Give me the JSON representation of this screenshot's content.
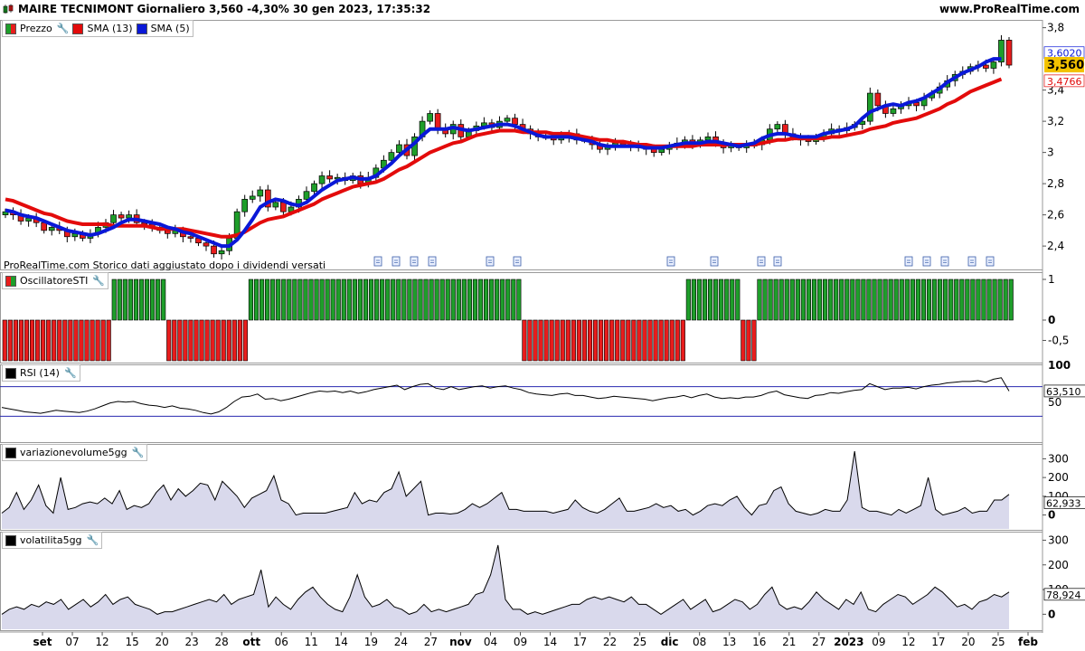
{
  "header": {
    "title": "MAIRE TECNIMONT Giornaliero 3,560 -4,30% 30 gen 2023, 17:35:32",
    "site": "www.ProRealTime.com"
  },
  "colors": {
    "bull": "#1e9e2a",
    "bear": "#e81c1c",
    "sma13": "#e30b0b",
    "sma5": "#0a18d8",
    "area_fill": "#d9d9ec",
    "rsi_band": "#2a2ab0",
    "last_price_bg": "#f2c200"
  },
  "panels": {
    "price": {
      "legend": [
        {
          "label": "Prezzo",
          "color": "#1e9e2a",
          "icon": "wrench-icon"
        },
        {
          "label": "SMA (13)",
          "color": "#e30b0b"
        },
        {
          "label": "SMA (5)",
          "color": "#0a18d8"
        }
      ],
      "note": "ProRealTime.com  Storico dati aggiustato dopo i dividendi versati",
      "last_price": "3,560",
      "sma5_value": "3,6020",
      "sma13_value": "3,4766"
    },
    "sti": {
      "title": "OscillatoreSTI",
      "last": "1"
    },
    "rsi": {
      "title": "RSI (14)",
      "last": "63,510"
    },
    "vol": {
      "title": "variazionevolume5gg",
      "last": "62,933"
    },
    "vola": {
      "title": "volatilita5gg",
      "last": "78,924"
    }
  },
  "chart_data": [
    {
      "type": "candlestick",
      "title": "MAIRE TECNIMONT Giornaliero",
      "yticks": [
        "2,4",
        "2,6",
        "2,8",
        "3",
        "3,2",
        "3,4",
        "3,8"
      ],
      "ylim": [
        2.25,
        3.85
      ],
      "dates": [
        "set",
        "07",
        "12",
        "15",
        "20",
        "23",
        "28",
        "ott",
        "06",
        "11",
        "14",
        "19",
        "24",
        "27",
        "nov",
        "04",
        "09",
        "14",
        "17",
        "22",
        "25",
        "dic",
        "08",
        "13",
        "16",
        "21",
        "27",
        "2023",
        "09",
        "12",
        "17",
        "20",
        "25",
        "feb"
      ],
      "close": [
        2.62,
        2.6,
        2.56,
        2.58,
        2.55,
        2.5,
        2.52,
        2.5,
        2.46,
        2.48,
        2.45,
        2.48,
        2.52,
        2.55,
        2.6,
        2.58,
        2.6,
        2.55,
        2.54,
        2.52,
        2.5,
        2.48,
        2.5,
        2.46,
        2.45,
        2.42,
        2.4,
        2.35,
        2.37,
        2.45,
        2.62,
        2.7,
        2.72,
        2.76,
        2.65,
        2.68,
        2.62,
        2.65,
        2.7,
        2.75,
        2.8,
        2.85,
        2.83,
        2.84,
        2.82,
        2.85,
        2.8,
        2.84,
        2.9,
        2.95,
        3.0,
        3.05,
        2.98,
        3.1,
        3.2,
        3.25,
        3.15,
        3.12,
        3.18,
        3.1,
        3.14,
        3.17,
        3.19,
        3.16,
        3.2,
        3.22,
        3.18,
        3.15,
        3.12,
        3.1,
        3.1,
        3.08,
        3.1,
        3.12,
        3.08,
        3.08,
        3.05,
        3.02,
        3.04,
        3.06,
        3.05,
        3.04,
        3.03,
        3.02,
        3.0,
        3.02,
        3.04,
        3.06,
        3.08,
        3.05,
        3.08,
        3.1,
        3.06,
        3.03,
        3.04,
        3.03,
        3.05,
        3.05,
        3.08,
        3.15,
        3.18,
        3.12,
        3.1,
        3.08,
        3.07,
        3.1,
        3.12,
        3.15,
        3.14,
        3.16,
        3.18,
        3.2,
        3.38,
        3.3,
        3.25,
        3.28,
        3.3,
        3.32,
        3.3,
        3.35,
        3.38,
        3.42,
        3.46,
        3.5,
        3.52,
        3.55,
        3.56,
        3.54,
        3.58,
        3.72,
        3.56
      ],
      "sma13": [
        2.7,
        2.69,
        2.67,
        2.65,
        2.63,
        2.61,
        2.6,
        2.58,
        2.56,
        2.55,
        2.54,
        2.54,
        2.54,
        2.54,
        2.53,
        2.53,
        2.53,
        2.53,
        2.53,
        2.52,
        2.51,
        2.51,
        2.51,
        2.51,
        2.5,
        2.49,
        2.48,
        2.47,
        2.46,
        2.46,
        2.47,
        2.49,
        2.52,
        2.55,
        2.57,
        2.58,
        2.59,
        2.61,
        2.63,
        2.65,
        2.67,
        2.7,
        2.72,
        2.74,
        2.76,
        2.78,
        2.79,
        2.8,
        2.81,
        2.83,
        2.86,
        2.89,
        2.91,
        2.94,
        2.97,
        3.0,
        3.02,
        3.04,
        3.06,
        3.07,
        3.09,
        3.11,
        3.12,
        3.13,
        3.14,
        3.14,
        3.14,
        3.13,
        3.13,
        3.13,
        3.13,
        3.12,
        3.12,
        3.12,
        3.11,
        3.1,
        3.09,
        3.08,
        3.08,
        3.07,
        3.07,
        3.06,
        3.05,
        3.05,
        3.04,
        3.04,
        3.04,
        3.04,
        3.04,
        3.04,
        3.05,
        3.05,
        3.05,
        3.05,
        3.05,
        3.05,
        3.05,
        3.05,
        3.06,
        3.07,
        3.08,
        3.08,
        3.09,
        3.09,
        3.09,
        3.09,
        3.09,
        3.1,
        3.1,
        3.11,
        3.12,
        3.13,
        3.15,
        3.16,
        3.17,
        3.19,
        3.2,
        3.21,
        3.22,
        3.24,
        3.26,
        3.28,
        3.31,
        3.33,
        3.36,
        3.39,
        3.41,
        3.43,
        3.45,
        3.47
      ],
      "sma5": [
        2.63,
        2.62,
        2.6,
        2.59,
        2.58,
        2.56,
        2.54,
        2.52,
        2.5,
        2.49,
        2.48,
        2.47,
        2.48,
        2.5,
        2.52,
        2.55,
        2.57,
        2.57,
        2.56,
        2.55,
        2.54,
        2.52,
        2.51,
        2.49,
        2.48,
        2.46,
        2.44,
        2.42,
        2.4,
        2.4,
        2.44,
        2.5,
        2.57,
        2.65,
        2.68,
        2.7,
        2.69,
        2.67,
        2.66,
        2.68,
        2.72,
        2.76,
        2.79,
        2.82,
        2.83,
        2.84,
        2.83,
        2.83,
        2.85,
        2.89,
        2.93,
        2.98,
        3.02,
        3.06,
        3.11,
        3.15,
        3.15,
        3.15,
        3.16,
        3.15,
        3.14,
        3.15,
        3.16,
        3.17,
        3.18,
        3.18,
        3.17,
        3.15,
        3.13,
        3.11,
        3.1,
        3.1,
        3.1,
        3.1,
        3.09,
        3.08,
        3.07,
        3.05,
        3.04,
        3.04,
        3.04,
        3.04,
        3.04,
        3.03,
        3.03,
        3.03,
        3.04,
        3.05,
        3.06,
        3.06,
        3.06,
        3.07,
        3.07,
        3.06,
        3.05,
        3.04,
        3.05,
        3.06,
        3.09,
        3.11,
        3.12,
        3.12,
        3.11,
        3.1,
        3.1,
        3.1,
        3.12,
        3.13,
        3.14,
        3.15,
        3.17,
        3.22,
        3.26,
        3.28,
        3.3,
        3.31,
        3.3,
        3.32,
        3.33,
        3.35,
        3.38,
        3.41,
        3.45,
        3.48,
        3.51,
        3.53,
        3.55,
        3.58,
        3.6,
        3.6
      ]
    },
    {
      "type": "bar",
      "title": "OscillatoreSTI",
      "yticks": [
        "1",
        "0",
        "-0,5"
      ],
      "ylim": [
        -1,
        1
      ],
      "segments": [
        {
          "value": -1,
          "count": 20
        },
        {
          "value": 1,
          "count": 10
        },
        {
          "value": -1,
          "count": 15
        },
        {
          "value": 1,
          "count": 50
        },
        {
          "value": -1,
          "count": 30
        },
        {
          "value": 1,
          "count": 10
        },
        {
          "value": -1,
          "count": 3
        },
        {
          "value": 1,
          "count": 47
        }
      ]
    },
    {
      "type": "line",
      "title": "RSI (14)",
      "yticks": [
        "100",
        "50"
      ],
      "ylim": [
        0,
        100
      ],
      "bands": [
        30,
        70
      ],
      "values": [
        42,
        40,
        38,
        36,
        35,
        34,
        36,
        38,
        37,
        36,
        35,
        37,
        40,
        44,
        48,
        50,
        49,
        50,
        47,
        45,
        44,
        42,
        44,
        41,
        40,
        38,
        35,
        33,
        36,
        42,
        50,
        56,
        57,
        60,
        53,
        54,
        51,
        53,
        56,
        59,
        62,
        64,
        63,
        64,
        62,
        64,
        61,
        63,
        66,
        68,
        70,
        72,
        66,
        70,
        73,
        74,
        68,
        66,
        70,
        66,
        68,
        70,
        71,
        68,
        70,
        71,
        68,
        66,
        62,
        60,
        59,
        58,
        60,
        61,
        58,
        58,
        56,
        54,
        55,
        57,
        56,
        55,
        54,
        53,
        51,
        53,
        55,
        56,
        58,
        55,
        58,
        60,
        56,
        54,
        55,
        54,
        56,
        56,
        58,
        62,
        64,
        59,
        57,
        55,
        54,
        58,
        59,
        62,
        61,
        63,
        65,
        66,
        74,
        70,
        66,
        68,
        68,
        69,
        67,
        70,
        72,
        73,
        75,
        76,
        77,
        77,
        78,
        76,
        80,
        82,
        64
      ]
    },
    {
      "type": "area",
      "title": "variazionevolume5gg",
      "yticks": [
        "300",
        "200",
        "100",
        "0"
      ],
      "ylim": [
        -60,
        360
      ],
      "values": [
        10,
        40,
        120,
        30,
        80,
        160,
        50,
        10,
        200,
        30,
        40,
        60,
        70,
        60,
        90,
        60,
        130,
        30,
        50,
        40,
        60,
        120,
        160,
        80,
        140,
        100,
        130,
        170,
        160,
        80,
        180,
        140,
        100,
        40,
        90,
        110,
        130,
        210,
        80,
        60,
        0,
        10,
        10,
        10,
        10,
        20,
        30,
        40,
        120,
        60,
        80,
        70,
        120,
        140,
        230,
        100,
        140,
        180,
        0,
        10,
        10,
        5,
        10,
        30,
        60,
        40,
        60,
        90,
        120,
        30,
        30,
        20,
        20,
        20,
        20,
        10,
        20,
        30,
        80,
        40,
        20,
        10,
        30,
        60,
        90,
        20,
        20,
        30,
        40,
        60,
        40,
        50,
        20,
        30,
        0,
        20,
        50,
        60,
        50,
        80,
        100,
        40,
        0,
        50,
        60,
        130,
        150,
        60,
        20,
        10,
        0,
        10,
        30,
        20,
        20,
        80,
        340,
        40,
        20,
        20,
        10,
        0,
        30,
        10,
        30,
        50,
        200,
        30,
        0,
        10,
        20,
        40,
        10,
        20,
        20,
        80,
        80,
        110
      ]
    },
    {
      "type": "area",
      "title": "volatilita5gg",
      "yticks": [
        "300",
        "200",
        "100",
        "0"
      ],
      "ylim": [
        -50,
        320
      ],
      "values": [
        0,
        20,
        30,
        20,
        40,
        30,
        50,
        40,
        60,
        20,
        40,
        60,
        30,
        50,
        80,
        40,
        60,
        70,
        40,
        30,
        20,
        0,
        10,
        10,
        20,
        30,
        40,
        50,
        60,
        50,
        80,
        40,
        60,
        70,
        80,
        180,
        30,
        70,
        40,
        20,
        60,
        90,
        110,
        70,
        40,
        20,
        10,
        70,
        160,
        70,
        30,
        40,
        60,
        30,
        20,
        0,
        10,
        40,
        10,
        20,
        10,
        20,
        30,
        40,
        80,
        90,
        160,
        280,
        60,
        20,
        20,
        0,
        10,
        0,
        10,
        20,
        30,
        40,
        40,
        60,
        70,
        60,
        70,
        60,
        50,
        70,
        40,
        40,
        20,
        0,
        20,
        40,
        60,
        20,
        40,
        60,
        10,
        20,
        40,
        60,
        50,
        20,
        40,
        80,
        110,
        40,
        20,
        30,
        20,
        50,
        90,
        60,
        40,
        20,
        60,
        40,
        90,
        20,
        10,
        40,
        60,
        80,
        70,
        40,
        60,
        80,
        110,
        90,
        60,
        30,
        40,
        20,
        50,
        60,
        80,
        70,
        90
      ]
    }
  ]
}
